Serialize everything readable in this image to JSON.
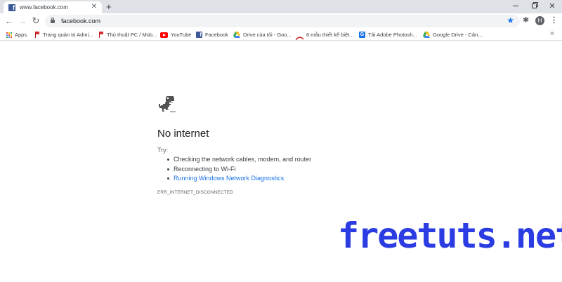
{
  "browser": {
    "tab": {
      "title": "www.facebook.com",
      "favicon": "facebook-icon"
    },
    "new_tab_symbol": "+",
    "toolbar": {
      "url": "facebook.com",
      "profile_initial": "H"
    },
    "bookmarks": [
      {
        "label": "Apps",
        "icon": "apps-grid-icon"
      },
      {
        "label": "Trang quản trị Admi...",
        "icon": "flag-icon"
      },
      {
        "label": "Thủ thuật PC / Mob...",
        "icon": "flag-icon"
      },
      {
        "label": "YouTube",
        "icon": "youtube-icon"
      },
      {
        "label": "Facebook",
        "icon": "facebook-icon"
      },
      {
        "label": "Drive của tôi - Goo...",
        "icon": "google-drive-icon"
      },
      {
        "label": "6 mẫu thiết kế biệt...",
        "icon": "arc-logo-icon"
      },
      {
        "label": "Tải Adobe Photosh...",
        "icon": "gt-icon"
      },
      {
        "label": "Google Drive - Cân...",
        "icon": "google-drive-icon"
      }
    ]
  },
  "error_page": {
    "title": "No internet",
    "try_label": "Try:",
    "suggestions": [
      "Checking the network cables, modem, and router",
      "Reconnecting to Wi-Fi",
      "Running Windows Network Diagnostics"
    ],
    "error_code": "ERR_INTERNET_DISCONNECTED"
  },
  "watermark": "freetuts.net",
  "colors": {
    "tabstrip_bg": "#dee1e6",
    "link_blue": "#1a73e8",
    "watermark_blue": "#2a3ce2"
  }
}
